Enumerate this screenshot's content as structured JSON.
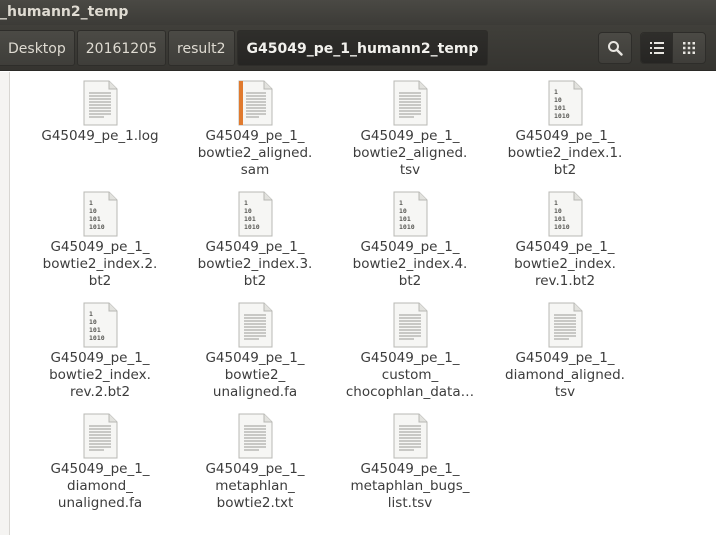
{
  "window": {
    "title": "_humann2_temp"
  },
  "breadcrumbs": [
    {
      "label": "Desktop"
    },
    {
      "label": "20161205"
    },
    {
      "label": "result2"
    },
    {
      "label": "G45049_pe_1_humann2_temp"
    }
  ],
  "toolbar": {
    "search_icon": "search-icon",
    "list_view_icon": "list-view-icon",
    "grid_view_icon": "grid-view-icon"
  },
  "files": [
    {
      "label": "G45049_pe_1.log",
      "icon": "text-file-icon"
    },
    {
      "label": "G45049_pe_1_\nbowtie2_aligned.\nsam",
      "icon": "sam-file-icon"
    },
    {
      "label": "G45049_pe_1_\nbowtie2_aligned.\ntsv",
      "icon": "text-file-icon"
    },
    {
      "label": "G45049_pe_1_\nbowtie2_index.1.\nbt2",
      "icon": "binary-file-icon"
    },
    {
      "label": "G45049_pe_1_\nbowtie2_index.2.\nbt2",
      "icon": "binary-file-icon"
    },
    {
      "label": "G45049_pe_1_\nbowtie2_index.3.\nbt2",
      "icon": "binary-file-icon"
    },
    {
      "label": "G45049_pe_1_\nbowtie2_index.4.\nbt2",
      "icon": "binary-file-icon"
    },
    {
      "label": "G45049_pe_1_\nbowtie2_index.\nrev.1.bt2",
      "icon": "binary-file-icon"
    },
    {
      "label": "G45049_pe_1_\nbowtie2_index.\nrev.2.bt2",
      "icon": "binary-file-icon"
    },
    {
      "label": "G45049_pe_1_\nbowtie2_\nunaligned.fa",
      "icon": "text-file-icon"
    },
    {
      "label": "G45049_pe_1_\ncustom_\nchocophlan_data…",
      "icon": "text-file-icon"
    },
    {
      "label": "G45049_pe_1_\ndiamond_aligned.\ntsv",
      "icon": "text-file-icon"
    },
    {
      "label": "G45049_pe_1_\ndiamond_\nunaligned.fa",
      "icon": "text-file-icon"
    },
    {
      "label": "G45049_pe_1_\nmetaphlan_\nbowtie2.txt",
      "icon": "text-file-icon"
    },
    {
      "label": "G45049_pe_1_\nmetaphlan_bugs_\nlist.tsv",
      "icon": "text-file-icon"
    }
  ],
  "binary_glyph": {
    "l1": "1",
    "l2": "10",
    "l3": "101",
    "l4": "1010"
  },
  "colors": {
    "titlebar": "#3c3b37",
    "accent_sam": "#e07a2e",
    "text": "#3c3c3c"
  }
}
